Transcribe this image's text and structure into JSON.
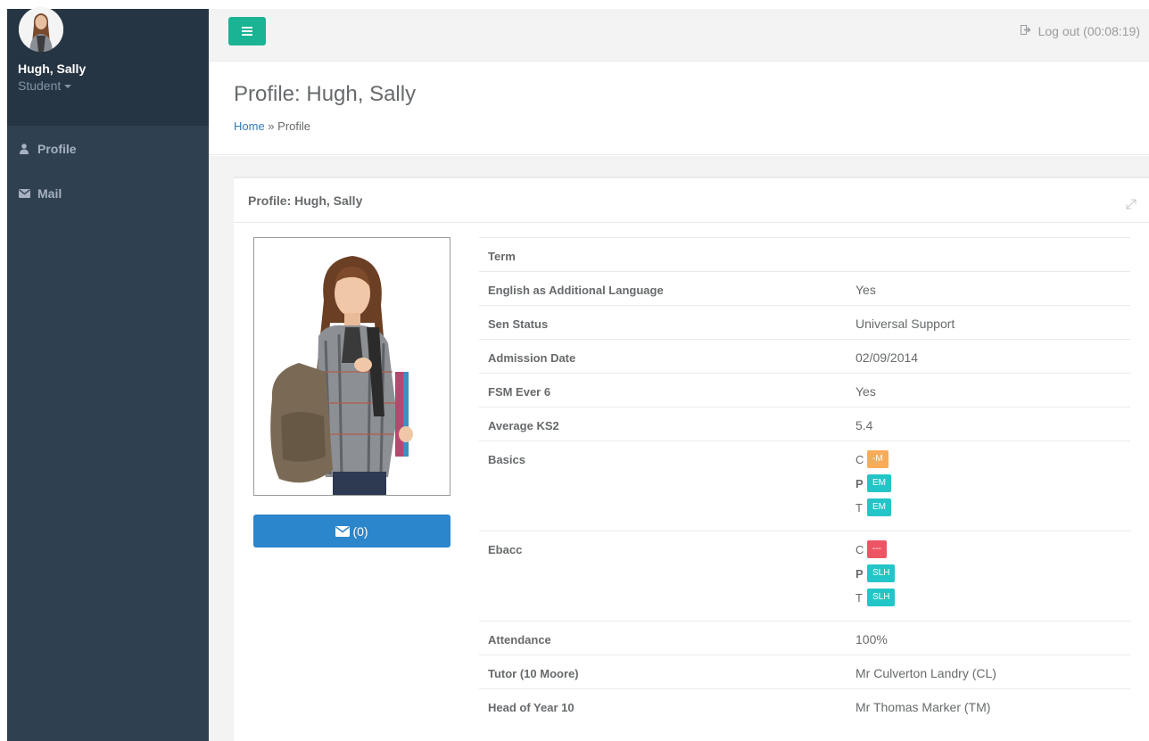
{
  "sidebar": {
    "user_name": "Hugh, Sally",
    "user_role": "Student",
    "nav": [
      {
        "label": "Profile",
        "icon": "user-icon"
      },
      {
        "label": "Mail",
        "icon": "envelope-icon"
      }
    ]
  },
  "topbar": {
    "menu_icon": "hamburger-icon",
    "logout_label": "Log out (00:08:19)",
    "logout_icon": "sign-out-icon"
  },
  "heading": {
    "title": "Profile: Hugh, Sally",
    "breadcrumb_home": "Home",
    "breadcrumb_sep": " » ",
    "breadcrumb_current": "Profile"
  },
  "panel": {
    "title": "Profile: Hugh, Sally",
    "mail_button_label": "(0)",
    "mail_button_icon": "envelope-icon"
  },
  "profile": {
    "rows": [
      {
        "label": "Term",
        "value": ""
      },
      {
        "label": "English as Additional Language",
        "value": "Yes"
      },
      {
        "label": "Sen Status",
        "value": "Universal Support"
      },
      {
        "label": "Admission Date",
        "value": "02/09/2014"
      },
      {
        "label": "FSM Ever 6",
        "value": "Yes"
      },
      {
        "label": "Average KS2",
        "value": "5.4"
      }
    ],
    "basics": {
      "label": "Basics",
      "lines": [
        {
          "prefix": "C",
          "badge": "-M",
          "color": "#f8ac59"
        },
        {
          "prefix": "P",
          "badge": "EM",
          "color": "#23c6c8"
        },
        {
          "prefix": "T",
          "badge": "EM",
          "color": "#23c6c8"
        }
      ]
    },
    "ebacc": {
      "label": "Ebacc",
      "lines": [
        {
          "prefix": "C",
          "badge": "---",
          "color": "#ed5565"
        },
        {
          "prefix": "P",
          "badge": "SLH",
          "color": "#23c6c8"
        },
        {
          "prefix": "T",
          "badge": "SLH",
          "color": "#23c6c8"
        }
      ]
    },
    "rows_after": [
      {
        "label": "Attendance",
        "value": "100%"
      },
      {
        "label": "Tutor (10 Moore)",
        "value": "Mr Culverton Landry (CL)"
      },
      {
        "label": "Head of Year 10",
        "value": "Mr Thomas Marker (TM)"
      }
    ]
  },
  "colors": {
    "sidebar": "#2f4050",
    "accent": "#1ab394",
    "primary_button": "#2b86cb"
  }
}
